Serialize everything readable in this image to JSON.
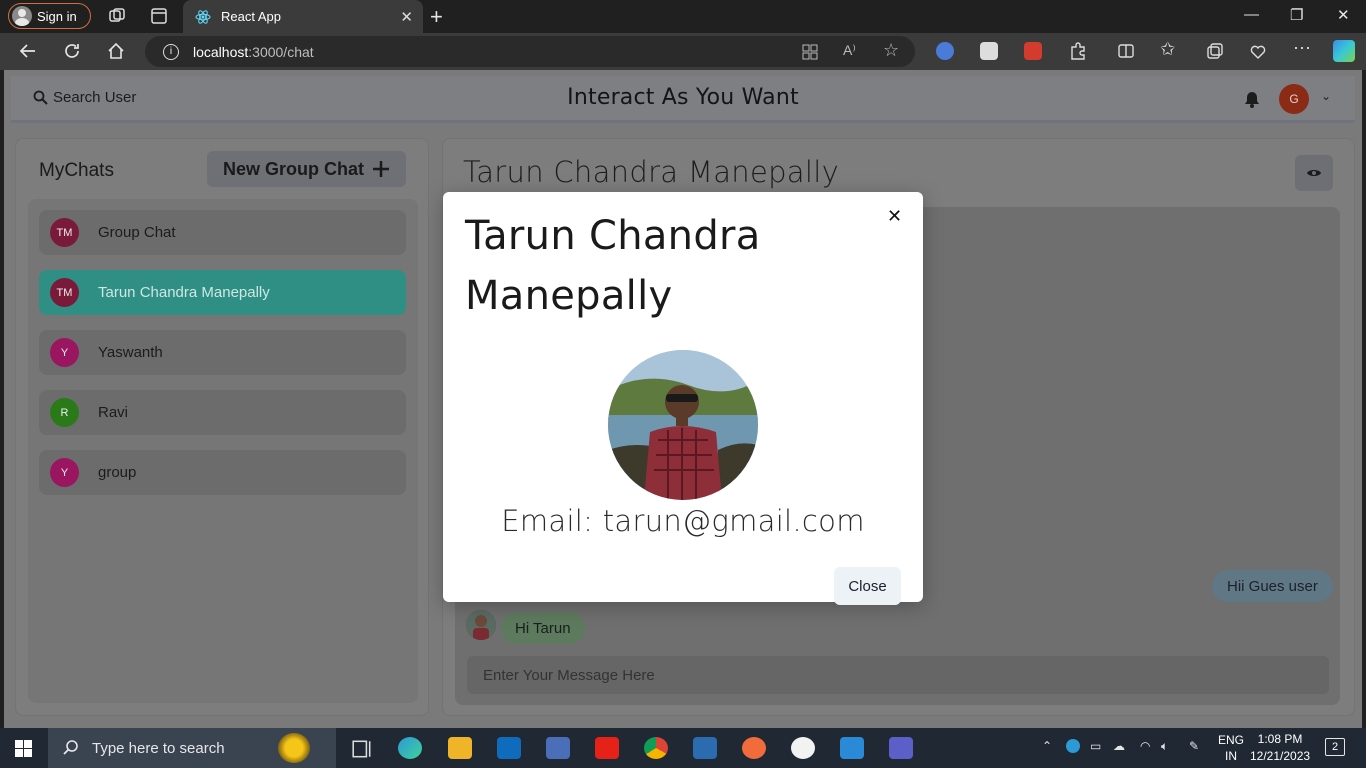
{
  "browser": {
    "signin_label": "Sign in",
    "tab_title": "React App",
    "url_host": "localhost",
    "url_path": ":3000/chat"
  },
  "header": {
    "search_label": "Search User",
    "title": "Interact As You Want",
    "user_initial": "G"
  },
  "sidebar": {
    "title": "MyChats",
    "new_group_label": "New Group Chat",
    "chats": [
      {
        "initials": "TM",
        "name": "Group Chat",
        "color": "#7a1a3a",
        "active": false
      },
      {
        "initials": "TM",
        "name": "Tarun Chandra Manepally",
        "color": "#7a1a3a",
        "active": true
      },
      {
        "initials": "Y",
        "name": "Yaswanth",
        "color": "#9a1660",
        "active": false
      },
      {
        "initials": "R",
        "name": "Ravi",
        "color": "#2a7a1a",
        "active": false
      },
      {
        "initials": "Y",
        "name": "group",
        "color": "#9a1660",
        "active": false
      }
    ]
  },
  "chat": {
    "title": "Tarun Chandra Manepally",
    "messages": [
      {
        "text": "Hii Gues user",
        "side": "right"
      },
      {
        "text": "Hi Tarun",
        "side": "left"
      }
    ],
    "input_placeholder": "Enter Your Message Here"
  },
  "modal": {
    "title": "Tarun Chandra Manepally",
    "email": "Email: tarun@gmail.com",
    "close_label": "Close"
  },
  "taskbar": {
    "search_placeholder": "Type here to search",
    "lang_top": "ENG",
    "lang_bottom": "IN",
    "time": "1:08 PM",
    "date": "12/21/2023",
    "notification_count": "2"
  },
  "colors": {
    "accent_teal": "#319795",
    "avatar_user": "#8b2a15"
  }
}
